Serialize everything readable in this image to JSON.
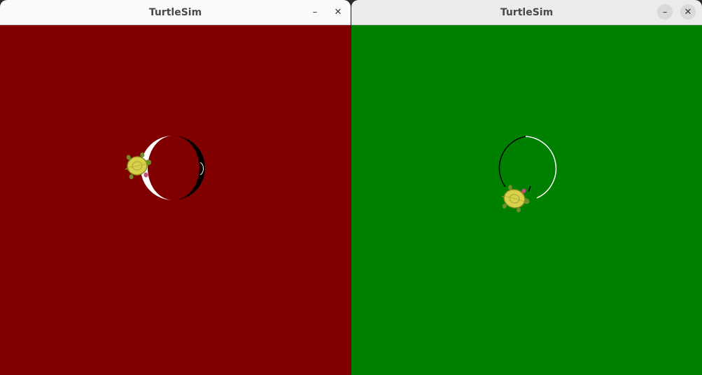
{
  "windows": [
    {
      "title": "TurtleSim",
      "minimize_glyph": "–",
      "close_glyph": "✕",
      "background": "#800000"
    },
    {
      "title": "TurtleSim",
      "minimize_glyph": "–",
      "close_glyph": "✕",
      "background": "#008000"
    }
  ],
  "icons": {
    "minimize": "minimize-icon",
    "close": "close-icon",
    "turtle": "turtle-icon"
  },
  "colors": {
    "shell_yellow": "#d8d24a",
    "shell_edge": "#8a8a20",
    "limb_green": "#6e8f2a",
    "feet_pink": "#c0507a",
    "pen_white": "#ffffff",
    "pen_black": "#000000"
  }
}
